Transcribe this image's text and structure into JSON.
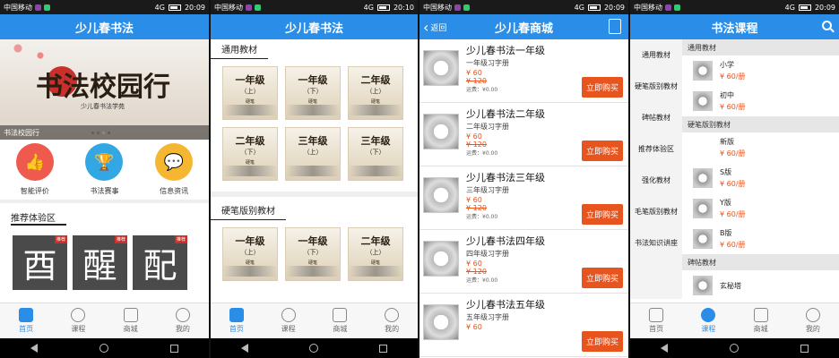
{
  "status": {
    "carrier": "中国移动",
    "network": "4G",
    "times": [
      "20:09",
      "20:10",
      "20:09",
      "20:09"
    ]
  },
  "colors": {
    "accent": "#2a8ee8",
    "price": "#e8541e"
  },
  "screen1": {
    "title": "少儿春书法",
    "banner": {
      "headline": "书法校园行",
      "subline": "少儿春书法学苑",
      "caption": "书法校园行"
    },
    "quick": [
      {
        "label": "智能评价",
        "icon": "thumbs-up-icon",
        "color": "#ef5a4e"
      },
      {
        "label": "书法赛事",
        "icon": "trophy-icon",
        "color": "#33a7e3"
      },
      {
        "label": "信息资讯",
        "icon": "chat-icon",
        "color": "#f5b731"
      }
    ],
    "section": "推荐体验区",
    "chars": [
      {
        "char": "酉",
        "tag": "推荐"
      },
      {
        "char": "醒",
        "tag": "推荐"
      },
      {
        "char": "配",
        "tag": "推荐"
      }
    ]
  },
  "screen2": {
    "title": "少儿春书法",
    "section1": "通用教材",
    "books1": [
      {
        "t": "一年级",
        "s": "（上）",
        "n": "硬笔"
      },
      {
        "t": "一年级",
        "s": "（下）",
        "n": "硬笔"
      },
      {
        "t": "二年级",
        "s": "（上）",
        "n": "硬笔"
      },
      {
        "t": "二年级",
        "s": "（下）",
        "n": "硬笔"
      },
      {
        "t": "三年级",
        "s": "（上）",
        "n": ""
      },
      {
        "t": "三年级",
        "s": "（下）",
        "n": ""
      }
    ],
    "section2": "硬笔版别教材",
    "books2": [
      {
        "t": "一年级",
        "s": "（上）",
        "n": "硬笔"
      },
      {
        "t": "一年级",
        "s": "（下）",
        "n": "硬笔"
      },
      {
        "t": "二年级",
        "s": "（上）",
        "n": "硬笔"
      }
    ]
  },
  "screen3": {
    "title": "少儿春商城",
    "back": "返回",
    "buy_label": "立即购买",
    "products": [
      {
        "name": "少儿春书法一年级",
        "sub": "一年级习字册",
        "price": "¥ 60",
        "old": "¥ 120",
        "ship": "运费：¥0.00"
      },
      {
        "name": "少儿春书法二年级",
        "sub": "二年级习字册",
        "price": "¥ 60",
        "old": "¥ 120",
        "ship": "运费：¥0.00"
      },
      {
        "name": "少儿春书法三年级",
        "sub": "三年级习字册",
        "price": "¥ 60",
        "old": "¥ 120",
        "ship": "运费：¥0.00"
      },
      {
        "name": "少儿春书法四年级",
        "sub": "四年级习字册",
        "price": "¥ 60",
        "old": "¥ 120",
        "ship": "运费：¥0.00"
      },
      {
        "name": "少儿春书法五年级",
        "sub": "五年级习字册",
        "price": "¥ 60",
        "old": "",
        "ship": ""
      }
    ]
  },
  "screen4": {
    "title": "书法课程",
    "side": [
      "通用教材",
      "硬笔版别教材",
      "碑帖教材",
      "推荐体验区",
      "强化教材",
      "毛笔版别教材",
      "书法知识讲座"
    ],
    "groups": [
      {
        "head": "通用教材",
        "items": [
          {
            "n": "小学",
            "p": "¥ 60/册"
          },
          {
            "n": "初中",
            "p": "¥ 60/册"
          }
        ]
      },
      {
        "head": "硬笔版别教材",
        "items": [
          {
            "n": "新版",
            "p": "¥ 60/册"
          },
          {
            "n": "S版",
            "p": "¥ 60/册"
          },
          {
            "n": "Y版",
            "p": "¥ 60/册"
          },
          {
            "n": "B版",
            "p": "¥ 60/册"
          }
        ]
      },
      {
        "head": "碑帖教材",
        "items": [
          {
            "n": "玄秘塔",
            "p": ""
          }
        ]
      }
    ]
  },
  "tabs": [
    "首页",
    "课程",
    "商城",
    "我的"
  ]
}
